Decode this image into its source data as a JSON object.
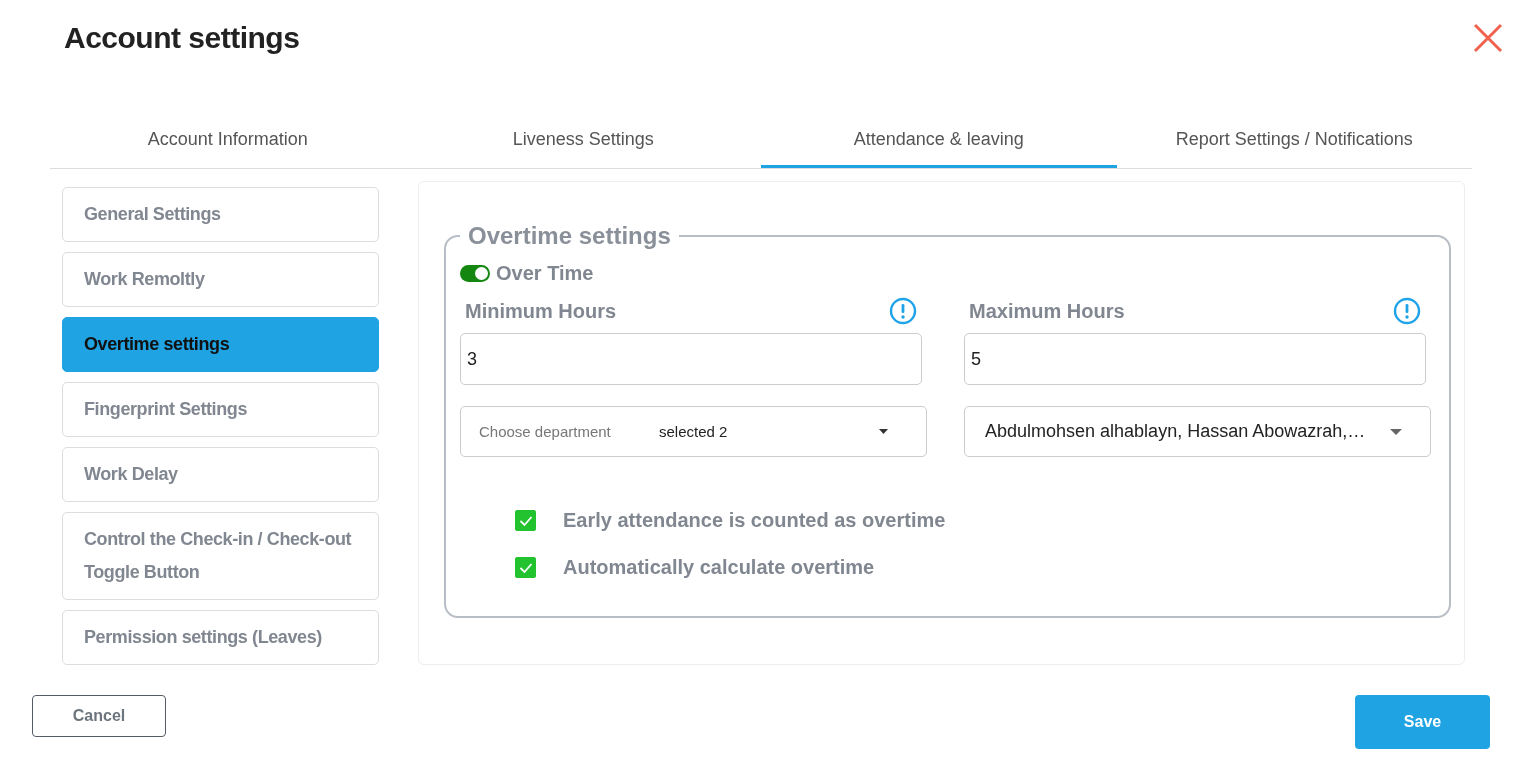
{
  "window": {
    "title": "Account settings"
  },
  "tabs": [
    {
      "label": "Account Information",
      "selected": false
    },
    {
      "label": "Liveness Settings",
      "selected": false
    },
    {
      "label": "Attendance & leaving",
      "selected": true
    },
    {
      "label": "Report Settings / Notifications",
      "selected": false
    }
  ],
  "sidebar": {
    "items": [
      {
        "label": "General Settings",
        "selected": false
      },
      {
        "label": "Work Remoltly",
        "selected": false
      },
      {
        "label": "Overtime settings",
        "selected": true
      },
      {
        "label": "Fingerprint Settings",
        "selected": false
      },
      {
        "label": "Work Delay",
        "selected": false
      },
      {
        "label": "Control the Check-in / Check-out Toggle Button",
        "selected": false
      },
      {
        "label": "Permission settings (Leaves)",
        "selected": false
      }
    ]
  },
  "section": {
    "legend": "Overtime settings",
    "toggle": {
      "label": "Over Time",
      "on": true
    },
    "minimum": {
      "label": "Minimum Hours",
      "value": "3"
    },
    "maximum": {
      "label": "Maximum Hours",
      "value": "5"
    },
    "department": {
      "placeholder": "Choose department",
      "value": "selected 2"
    },
    "employees": {
      "value": "Abdulmohsen alhablayn, Hassan Abowazrah,…"
    },
    "checkboxes": [
      {
        "label": "Early attendance is counted as overtime",
        "checked": true
      },
      {
        "label": "Automatically calculate overtime",
        "checked": true
      }
    ]
  },
  "buttons": {
    "cancel": "Cancel",
    "save": "Save"
  }
}
